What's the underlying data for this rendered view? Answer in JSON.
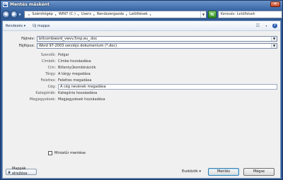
{
  "window": {
    "title": "Mentés másként",
    "app_icon": "W"
  },
  "nav": {
    "back_icon": "back-arrow-icon",
    "forward_icon": "forward-arrow-icon",
    "path": [
      "Számítógép",
      "WIN7 (C:)",
      "Users",
      "Rendszergazda",
      "Letöltések"
    ],
    "search_placeholder": "Keresés: Letöltések"
  },
  "toolbar": {
    "organize_label": "Rendezés",
    "new_folder_label": "Új mappa"
  },
  "file": {
    "name_label": "Fájlnév:",
    "name_value": "billcombword_vwvv.5mp.eu_.doc",
    "type_label": "Fájltípus:",
    "type_value": "Word 97-2003 verziójú dokumentum (*.doc)"
  },
  "meta": [
    {
      "label": "Szerzők:",
      "value": "Polgar"
    },
    {
      "label": "Címkék:",
      "value": "Címke hozzáadása"
    },
    {
      "label": "Cím:",
      "value": "Billentyűkombinációk"
    },
    {
      "label": "Tárgy:",
      "value": "A tárgy megadása"
    },
    {
      "label": "Felettes:",
      "value": "Felettes megadása"
    },
    {
      "label": "Cég:",
      "value": "A cég nevének megadása"
    },
    {
      "label": "Kategóriák:",
      "value": "Kategória hozzáadása"
    },
    {
      "label": "Megjegyzések:",
      "value": "Megjegyzések hozzáadása"
    }
  ],
  "thumbnail": {
    "label": "Miniatűr mentése",
    "checked": false
  },
  "footer": {
    "hide_folders_label": "Mappák elrejtése",
    "tools_label": "Eszközök",
    "save_label": "Mentés",
    "cancel_label": "Mégse"
  }
}
